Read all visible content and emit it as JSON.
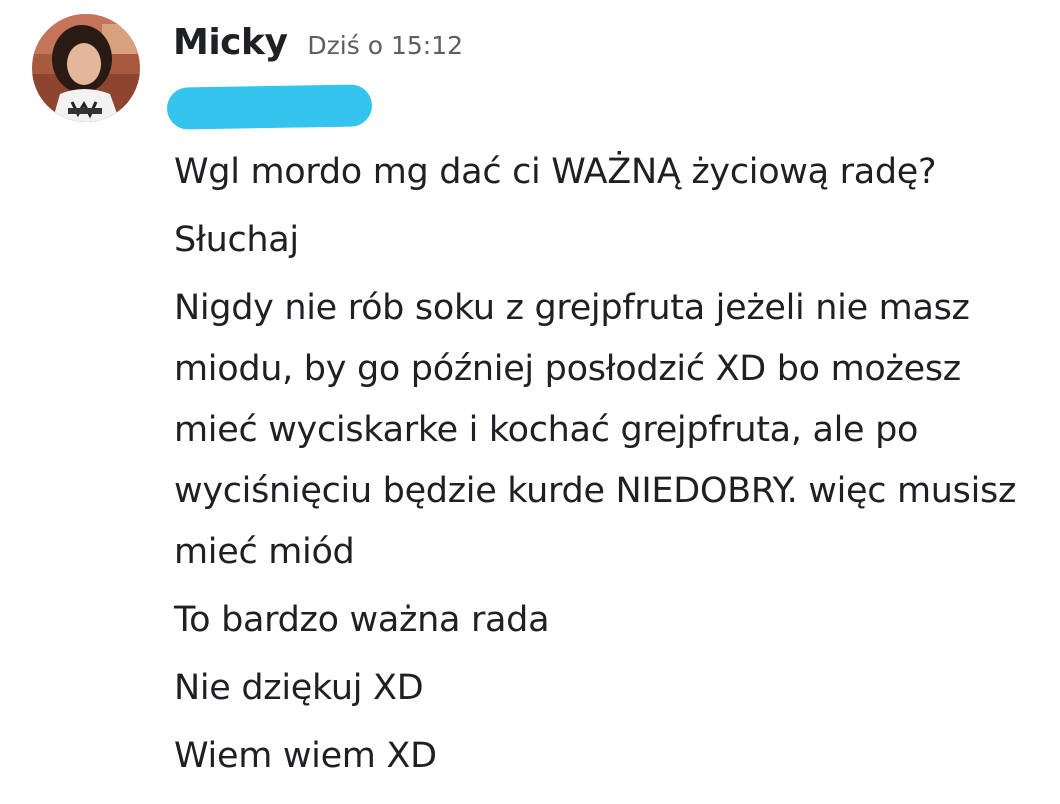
{
  "author": {
    "name": "Micky",
    "timestamp": "Dziś o 15:12"
  },
  "colors": {
    "redaction": "#34c4ee",
    "text": "#1f2024",
    "timestamp": "#5c5e66"
  },
  "messages": [
    "Wgl mordo mg dać ci WAŻNĄ życiową radę?",
    "Słuchaj",
    "Nigdy nie rób soku z grejpfruta jeżeli nie masz miodu, by go później posłodzić XD bo możesz mieć wyciskarke i kochać grejpfruta, ale po wyciśnięciu będzie kurde NIEDOBRY. więc musisz mieć miód",
    "To bardzo ważna rada",
    "Nie dziękuj XD",
    "Wiem wiem XD"
  ]
}
